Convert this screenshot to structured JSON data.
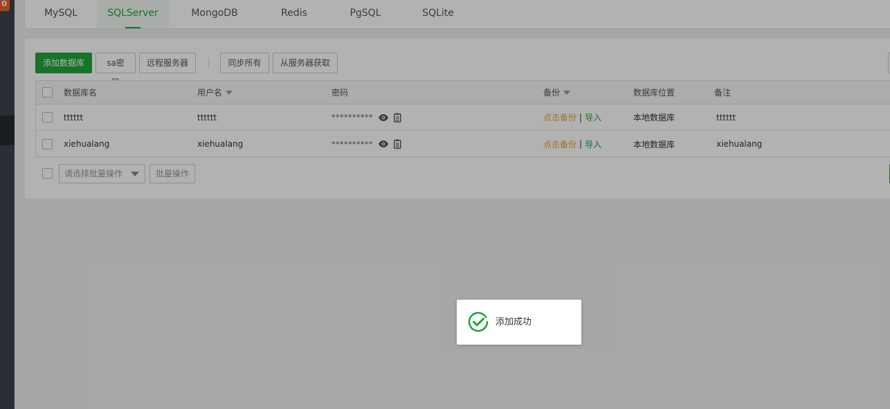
{
  "sidebar": {
    "badge": "0"
  },
  "tabs": [
    {
      "label": "MySQL"
    },
    {
      "label": "SQLServer"
    },
    {
      "label": "MongoDB"
    },
    {
      "label": "Redis"
    },
    {
      "label": "PgSQL"
    },
    {
      "label": "SQLite"
    }
  ],
  "active_tab": "SQLServer",
  "toolbar": {
    "add_db": "添加数据库",
    "sa_password": "sa密码",
    "remote_server": "远程服务器",
    "sync_all": "同步所有",
    "fetch_from_server": "从服务器获取"
  },
  "table": {
    "headers": {
      "db_name": "数据库名",
      "username": "用户名",
      "password": "密码",
      "backup": "备份",
      "location": "数据库位置",
      "remark": "备注"
    },
    "rows": [
      {
        "db_name": "tttttt",
        "username": "tttttt",
        "password_masked": "**********",
        "backup_link": "点击备份",
        "import_link": "导入",
        "separator": "|",
        "location": "本地数据库",
        "remark": "tttttt"
      },
      {
        "db_name": "xiehualang",
        "username": "xiehualang",
        "password_masked": "**********",
        "backup_link": "点击备份",
        "import_link": "导入",
        "separator": "|",
        "location": "本地数据库",
        "remark": "xiehualang"
      }
    ]
  },
  "batch": {
    "select_placeholder": "请选择批量操作",
    "batch_button": "批量操作"
  },
  "toast": {
    "message": "添加成功",
    "icon": "check-circle-icon",
    "color": "#20a53a"
  },
  "colors": {
    "primary": "#20a53a",
    "backup_link": "#e6a23c",
    "sidebar": "#3c444d"
  }
}
